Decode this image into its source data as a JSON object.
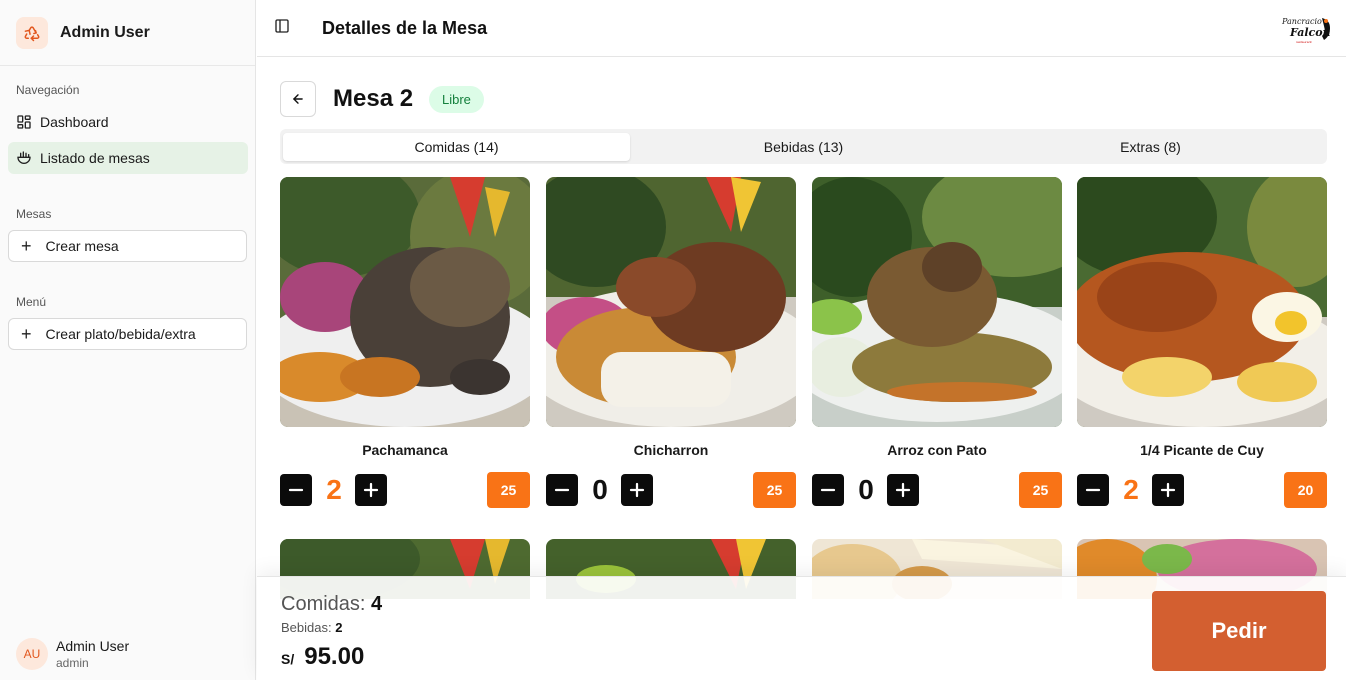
{
  "sidebar": {
    "app_title": "Admin User",
    "nav_heading": "Navegación",
    "nav_items": [
      {
        "label": "Dashboard",
        "icon": "dashboard-icon"
      },
      {
        "label": "Listado de mesas",
        "icon": "bowl-icon",
        "active": true
      }
    ],
    "mesas_heading": "Mesas",
    "create_table_label": "Crear mesa",
    "menu_heading": "Menú",
    "create_item_label": "Crear plato/bebida/extra",
    "user": {
      "initials": "AU",
      "name": "Admin User",
      "role": "admin"
    }
  },
  "header": {
    "title": "Detalles de la Mesa",
    "brand_logo": "Pancracio Falcon"
  },
  "table": {
    "title": "Mesa 2",
    "status": "Libre",
    "status_color": "#15803d"
  },
  "tabs": [
    {
      "label": "Comidas (14)",
      "active": true
    },
    {
      "label": "Bebidas (13)",
      "active": false
    },
    {
      "label": "Extras (8)",
      "active": false
    }
  ],
  "dishes": [
    {
      "name": "Pachamanca",
      "qty": "2",
      "price": "25"
    },
    {
      "name": "Chicharron",
      "qty": "0",
      "price": "25"
    },
    {
      "name": "Arroz con Pato",
      "qty": "0",
      "price": "25"
    },
    {
      "name": "1/4 Picante de Cuy",
      "qty": "2",
      "price": "20"
    }
  ],
  "footer": {
    "comidas_label": "Comidas:",
    "comidas_count": "4",
    "bebidas_label": "Bebidas:",
    "bebidas_count": "2",
    "currency": "S/",
    "total": "95.00",
    "order_label": "Pedir"
  },
  "colors": {
    "accent": "#f97316",
    "order_button": "#d35f30",
    "qty_active": "#f97316",
    "active_nav_bg": "#e6f2e6"
  }
}
